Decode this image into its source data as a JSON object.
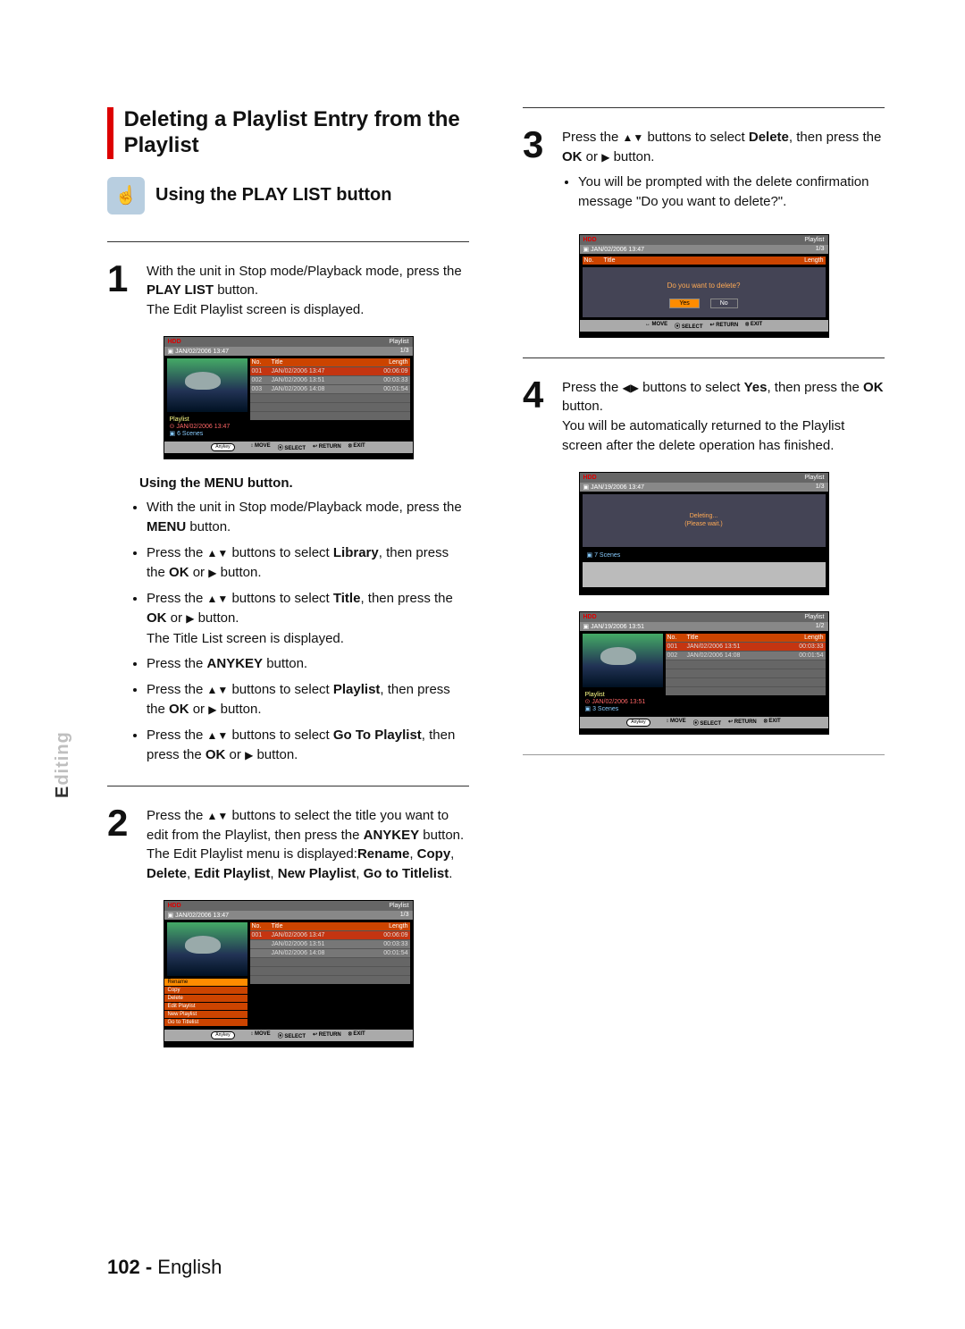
{
  "section_title": "Deleting a Playlist Entry from the Playlist",
  "sub_title": "Using the PLAY LIST button",
  "side_tab": {
    "grey": "E",
    "dark": "diting"
  },
  "step1": {
    "text_a": "With the unit in Stop mode/Playback mode, press the ",
    "bold_a": "PLAY LIST",
    "text_b": " button.",
    "text_c": "The Edit Playlist screen is displayed."
  },
  "menu_head": "Using the MENU button.",
  "menu_items": {
    "b1a": "With the unit in Stop mode/Playback mode, press the ",
    "b1b": "MENU",
    "b1c": " button.",
    "b2a": "Press the ",
    "b2b": " buttons to select ",
    "b2c": "Library",
    "b2d": ", then press the ",
    "b2e": "OK",
    "b2f": " or ",
    "b2g": " button.",
    "b3a": "Press the ",
    "b3b": " buttons to select ",
    "b3c": "Title",
    "b3d": ", then press the ",
    "b3e": "OK",
    "b3f": " or ",
    "b3g": " button.",
    "b3h": "The Title List screen is displayed.",
    "b4a": "Press the ",
    "b4b": "ANYKEY",
    "b4c": " button.",
    "b5a": "Press the ",
    "b5b": " buttons to select ",
    "b5c": "Playlist",
    "b5d": ", then press the ",
    "b5e": "OK",
    "b5f": " or ",
    "b5g": " button.",
    "b6a": "Press the ",
    "b6b": " buttons to select ",
    "b6c": "Go To Playlist",
    "b6d": ", then press the ",
    "b6e": "OK",
    "b6f": " or ",
    "b6g": " button."
  },
  "step2": {
    "a": "Press the ",
    "b": " buttons to select the title you want to edit from the Playlist, then press the ",
    "c": "ANYKEY",
    "d": " button.",
    "e": "The Edit Playlist menu is displayed:",
    "f": "Rename",
    "g": "Copy",
    "h": "Delete",
    "i": "Edit Playlist",
    "j": "New Playlist",
    "k": "Go to Titlelist"
  },
  "step3": {
    "a": "Press the ",
    "b": " buttons to select ",
    "c": "Delete",
    "d": ", then press the ",
    "e": "OK",
    "f": " or ",
    "g": " button.",
    "h": "You will be prompted with the delete confirmation message \"Do you want to delete?\"."
  },
  "step4": {
    "a": "Press the ",
    "b": " buttons to select ",
    "c": "Yes",
    "d": ", then press the ",
    "e": "OK",
    "f": " button.",
    "g": "You will be automatically returned to the Playlist screen after the delete operation has finished."
  },
  "osd": {
    "hdd": "HDD",
    "playlist": "Playlist",
    "date1": "JAN/02/2006 13:47",
    "date2": "JAN/19/2006 13:47",
    "date3": "JAN/19/2006 13:51",
    "pg13": "1/3",
    "pg12": "1/2",
    "headers": {
      "no": "No.",
      "title": "Title",
      "length": "Length"
    },
    "rows1": [
      {
        "no": "001",
        "title": "JAN/02/2006 13:47",
        "len": "00:06:09"
      },
      {
        "no": "002",
        "title": "JAN/02/2006 13:51",
        "len": "00:03:33"
      },
      {
        "no": "003",
        "title": "JAN/02/2006 14:08",
        "len": "00:01:54"
      }
    ],
    "rows2": [
      {
        "no": "001",
        "title": "JAN/02/2006 13:51",
        "len": "00:03:33"
      },
      {
        "no": "002",
        "title": "JAN/02/2006 14:08",
        "len": "00:01:54"
      }
    ],
    "info1_label": "Playlist",
    "info1_date": "JAN/02/2006 13:47",
    "info1_scenes": "6 Scenes",
    "info2_date": "JAN/02/2006 13:51",
    "info2_scenes": "7 Scenes",
    "info3_scenes": "3 Scenes",
    "menu": [
      "Rename",
      "Copy",
      "Delete",
      "Edit Playlist",
      "New Playlist",
      "Go to Titlelist"
    ],
    "dlg_msg": "Do you want to delete?",
    "dlg_yes": "Yes",
    "dlg_no": "No",
    "wait_a": "Deleting...",
    "wait_b": "(Please wait.)",
    "anykey": "Anykey",
    "bar": {
      "move": "MOVE",
      "select": "SELECT",
      "return": "RETURN",
      "exit": "EXIT"
    }
  },
  "footer": {
    "pg": "102 - ",
    "lang": "English"
  }
}
